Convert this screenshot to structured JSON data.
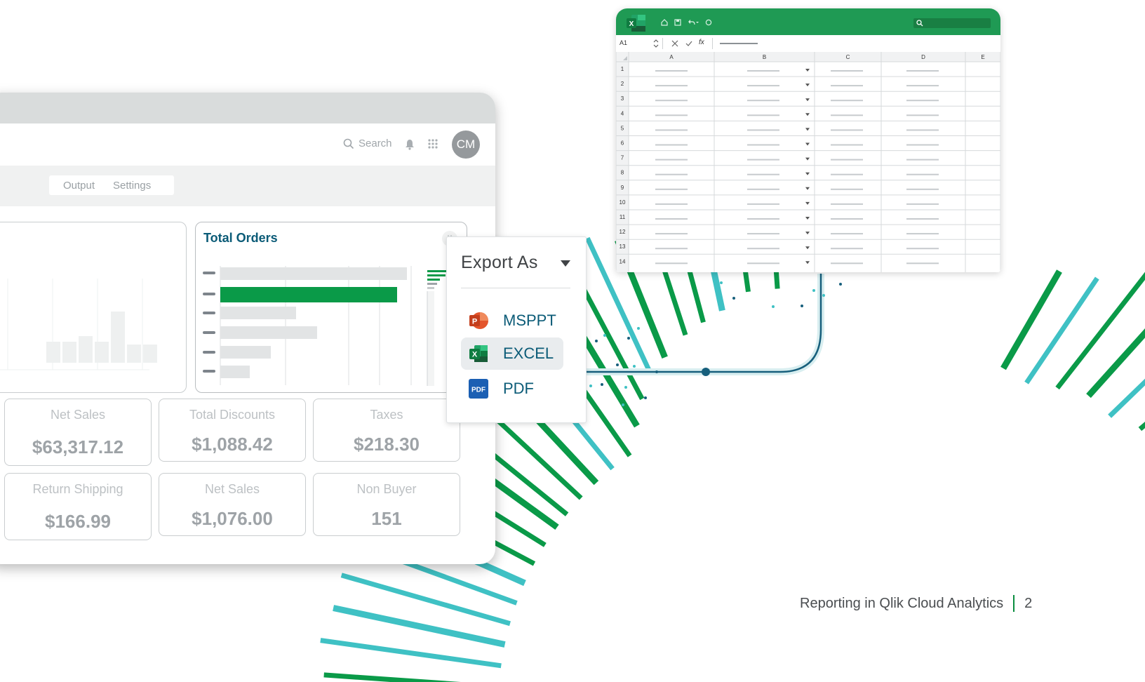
{
  "dashboard": {
    "search_label": "Search",
    "avatar_initials": "CM",
    "tabs": [
      "Output",
      "Settings"
    ],
    "orders_card": {
      "title": "Total Orders"
    },
    "kpis": [
      {
        "label": "Net Sales",
        "value": "$63,317.12"
      },
      {
        "label": "Total Discounts",
        "value": "$1,088.42"
      },
      {
        "label": "Taxes",
        "value": "$218.30"
      },
      {
        "label": "Return Shipping",
        "value": "$166.99"
      },
      {
        "label": "Net Sales",
        "value": "$1,076.00"
      },
      {
        "label": "Non Buyer",
        "value": "151"
      }
    ]
  },
  "export_menu": {
    "title": "Export As",
    "options": [
      {
        "label": "MSPPT",
        "icon": "powerpoint-icon"
      },
      {
        "label": "EXCEL",
        "icon": "excel-icon",
        "selected": true
      },
      {
        "label": "PDF",
        "icon": "pdf-icon"
      }
    ]
  },
  "spreadsheet": {
    "cell_ref": "A1",
    "formula_symbol": "fx",
    "columns": [
      "A",
      "B",
      "C",
      "D",
      "E"
    ],
    "rows": [
      "1",
      "2",
      "3",
      "4",
      "5",
      "6",
      "7",
      "8",
      "9",
      "10",
      "11",
      "12",
      "13",
      "14"
    ]
  },
  "footer": {
    "text": "Reporting in Qlik Cloud Analytics",
    "page": "2"
  },
  "colors": {
    "green": "#0a9a48",
    "teal": "#3fc1c4",
    "brand_blue": "#0b5b77",
    "excel_green": "#1f9a54"
  }
}
